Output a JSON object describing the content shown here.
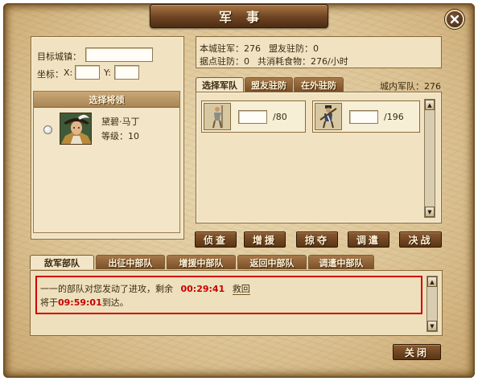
{
  "window": {
    "title": "军事",
    "close_icon": "close-icon"
  },
  "left_panel": {
    "target_city_label": "目标城镇：",
    "target_city_value": "",
    "coord_label": "坐标：",
    "x_label": "X:",
    "x_value": "",
    "y_label": "Y:",
    "y_value": "",
    "general_section_title": "选择将领",
    "general": {
      "name": "黛碧·马丁",
      "level_text": "等级：10"
    }
  },
  "info": {
    "city_troops": "本城驻军：276",
    "ally_garrison": "盟友驻防：0",
    "outpost_garrison": "据点驻防：0",
    "food_cost": "共消耗食物：276/小时"
  },
  "troop_tabs": [
    {
      "label": "选择军队",
      "active": true
    },
    {
      "label": "盟友驻防",
      "active": false
    },
    {
      "label": "在外驻防",
      "active": false
    }
  ],
  "city_troops_count": "城内军队：276",
  "troops": [
    {
      "icon": "spearman-icon",
      "value": "",
      "max": "/80"
    },
    {
      "icon": "musketeer-icon",
      "value": "",
      "max": "/196"
    }
  ],
  "actions": [
    "侦查",
    "增援",
    "掠夺",
    "调遣",
    "决战"
  ],
  "status_tabs": [
    {
      "label": "敌军部队",
      "active": true
    },
    {
      "label": "出征中部队",
      "active": false
    },
    {
      "label": "增援中部队",
      "active": false
    },
    {
      "label": "返回中部队",
      "active": false
    },
    {
      "label": "调遣中部队",
      "active": false
    }
  ],
  "log": {
    "line1_prefix": "一一的部队对您发动了进攻，剩余",
    "line1_time": "00:29:41",
    "line1_link": "救回",
    "line2_prefix": "将于",
    "line2_time": "09:59:01",
    "line2_suffix": "到达。"
  },
  "close_button_label": "关闭",
  "colors": {
    "highlight": "#d10000",
    "time_text": "#c80000",
    "banner": "#6e4322"
  }
}
